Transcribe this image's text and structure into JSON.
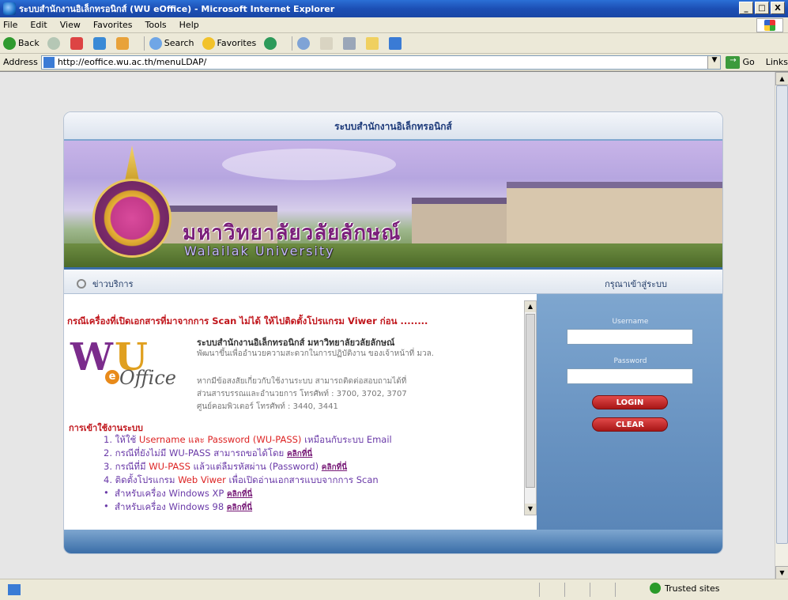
{
  "window": {
    "title": "ระบบสำนักงานอิเล็กทรอนิกส์ (WU eOffice) - Microsoft Internet Explorer",
    "controls": [
      "_",
      "□",
      "X"
    ]
  },
  "menu": [
    "File",
    "Edit",
    "View",
    "Favorites",
    "Tools",
    "Help"
  ],
  "toolbar": {
    "back": "Back",
    "search": "Search",
    "favorites": "Favorites"
  },
  "address": {
    "label": "Address",
    "url": "http://eoffice.wu.ac.th/menuLDAP/",
    "go": "Go",
    "links": "Links"
  },
  "page": {
    "header_title": "ระบบสำนักงานอิเล็กทรอนิกส์",
    "university_th": "มหาวิทยาลัยวลัยลักษณ์",
    "university_en": "Walailak University",
    "news_heading": "ข่าวบริการ",
    "login_heading": "กรุณาเข้าสู่ระบบ",
    "headline": "กรณีเครื่องที่เปิดเอกสารที่มาจากการ Scan ไม่ได้ ให้ไปติดตั้งโปรแกรม Viwer ก่อน ........",
    "logo": {
      "w": "W",
      "u": "U",
      "e": "e",
      "office": "Office"
    },
    "system_title": "ระบบสำนักงานอิเล็กทรอนิกส์ มหาวิทยาลัยวลัยลักษณ์",
    "system_subtitle": "พัฒนาขึ้นเพื่ออำนวยความสะดวกในการปฏิบัติงาน ของเจ้าหน้าที่ มวล.",
    "contact_line1": "หากมีข้อสงสัยเกี่ยวกับใช้งานระบบ สามารถติดต่อสอบถามได้ที่",
    "contact_line2": "ส่วนสารบรรณและอำนวยการ โทรศัพท์ : 3700, 3702, 3707",
    "contact_line3": "ศูนย์คอมพิวเตอร์ โทรศัพท์ : 3440, 3441",
    "howto_heading": "การเข้าใช้งานระบบ",
    "steps": [
      {
        "pre": "1. ให้ใช้ ",
        "red": "Username และ Password (WU-PASS)",
        "post": " เหมือนกับระบบ Email",
        "link": ""
      },
      {
        "pre": "2. กรณีที่ยังไม่มี WU-PASS สามารถขอได้โดย ",
        "red": "",
        "post": "",
        "link": "คลิกที่นี่"
      },
      {
        "pre": "3. กรณีที่มี ",
        "red": "WU-PASS",
        "post": " แล้วแต่ลืมรหัสผ่าน (Password) ",
        "link": "คลิกที่นี่"
      },
      {
        "pre": "4. ติดตั้งโปรแกรม ",
        "red": "Web Viwer",
        "post": " เพื่อเปิดอ่านเอกสารแบบจากการ Scan",
        "link": ""
      }
    ],
    "bullets": [
      {
        "text": "สำหรับเครื่อง Windows XP ",
        "link": "คลิกที่นี่"
      },
      {
        "text": "สำหรับเครื่อง Windows 98 ",
        "link": "คลิกที่นี่"
      }
    ],
    "login": {
      "username_label": "Username",
      "password_label": "Password",
      "username_value": "",
      "password_value": "",
      "login_button": "LOGIN",
      "clear_button": "CLEAR"
    }
  },
  "status": {
    "zone": "Trusted sites"
  },
  "colors": {
    "titlebar": "#1c4fb4",
    "accent_blue": "#3a6ea8",
    "headline_red": "#c0151b",
    "step_purple": "#6a3aa8"
  }
}
